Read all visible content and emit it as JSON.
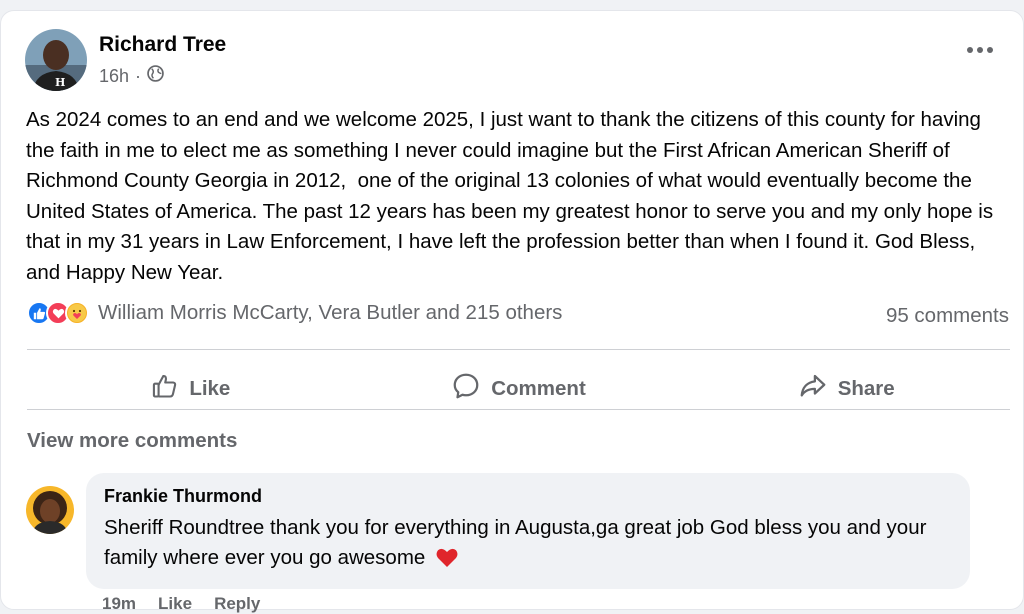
{
  "post": {
    "author": "Richard Tree",
    "time": "16h",
    "separator": "·",
    "privacy_icon": "globe-icon",
    "text": "As 2024 comes to an end and we welcome 2025, I just want to thank the citizens of this county for having the faith in me to elect me as something I never could imagine but the First African American Sheriff of Richmond County Georgia in 2012,  one of the original 13 colonies of what would eventually become the United States of America. The past 12 years has been my greatest honor to serve you and my only hope is that in my 31 years in Law Enforcement, I have left the profession better than when I found it. God Bless, and Happy New Year.",
    "reactions": {
      "icons": [
        "like-icon",
        "love-icon",
        "care-icon"
      ],
      "text": "William Morris McCarty, Vera Butler and 215 others"
    },
    "comments_count": "95 comments",
    "actions": {
      "like": "Like",
      "comment": "Comment",
      "share": "Share"
    }
  },
  "comments": {
    "view_more": "View more comments",
    "items": [
      {
        "author": "Frankie Thurmond",
        "text": "Sheriff Roundtree thank you for everything in Augusta,ga great job God bless you and your family where ever you go awesome",
        "emoji": "❤️",
        "time": "19m",
        "like": "Like",
        "reply": "Reply"
      }
    ]
  },
  "colors": {
    "accent": "#1877f2",
    "love": "#f33e58",
    "care": "#f7b125",
    "secondary_text": "#65676b",
    "bubble": "#f0f2f5"
  }
}
